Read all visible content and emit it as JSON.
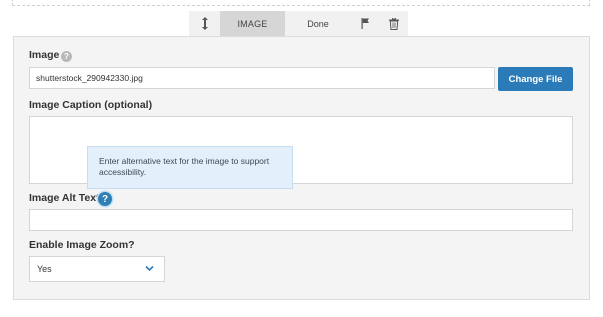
{
  "toolbar": {
    "move_icon": "move-vertical-icon",
    "image_label": "IMAGE",
    "done_label": "Done",
    "flag_icon": "flag-icon",
    "trash_icon": "trash-icon"
  },
  "form": {
    "image": {
      "label": "Image",
      "help_glyph": "?",
      "file_value": "shutterstock_290942330.jpg",
      "change_button": "Change File"
    },
    "caption": {
      "label": "Image Caption (optional)",
      "value": ""
    },
    "tooltip": {
      "text": "Enter alternative text for the image to support accessibility."
    },
    "alt_text": {
      "label": "Image Alt Text",
      "help_glyph": "?",
      "value": ""
    },
    "zoom": {
      "label": "Enable Image Zoom?",
      "selected": "Yes"
    }
  },
  "colors": {
    "accent": "#2b7bb9",
    "panel_bg": "#f4f4f4",
    "tooltip_bg": "#e3f0fb"
  }
}
